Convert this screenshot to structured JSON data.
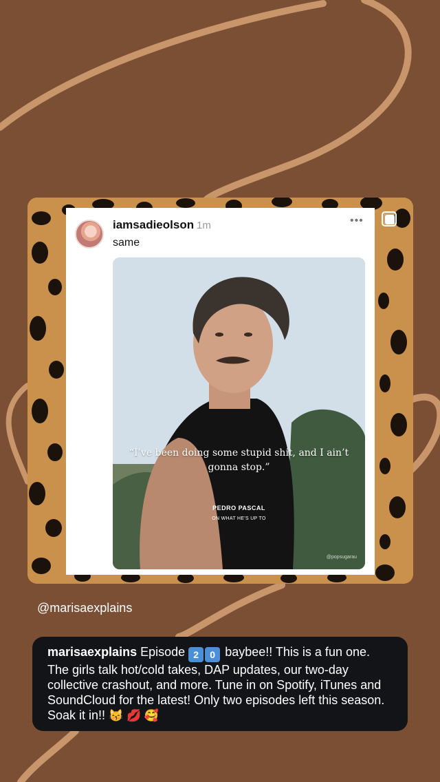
{
  "post": {
    "username": "iamsadieolson",
    "time": "1m",
    "more": "•••",
    "text": "same",
    "quote": "“I’ve been doing some stupid shit, and I ain’t gonna stop.”",
    "quote_name": "PEDRO PASCAL",
    "quote_sub": "ON WHAT HE'S UP TO",
    "watermark": "@popsugarau"
  },
  "mention": "@marisaexplains",
  "caption": {
    "username": "marisaexplains",
    "episode_prefix": "Episode",
    "badge_1": "2",
    "badge_2": "0",
    "text": "baybee!! This is a fun one. The girls talk hot/cold takes, DAP updates, our two-day collective crashout, and more. Tune in on Spotify, iTunes and SoundCloud for the latest! Only two episodes left this season. Soak it in!!",
    "emojis": "😽 💋 🥰"
  },
  "colors": {
    "background": "#7a4f34",
    "swirl": "#c9956a",
    "caption_bg": "#131417",
    "badge": "#4b8fd6"
  }
}
